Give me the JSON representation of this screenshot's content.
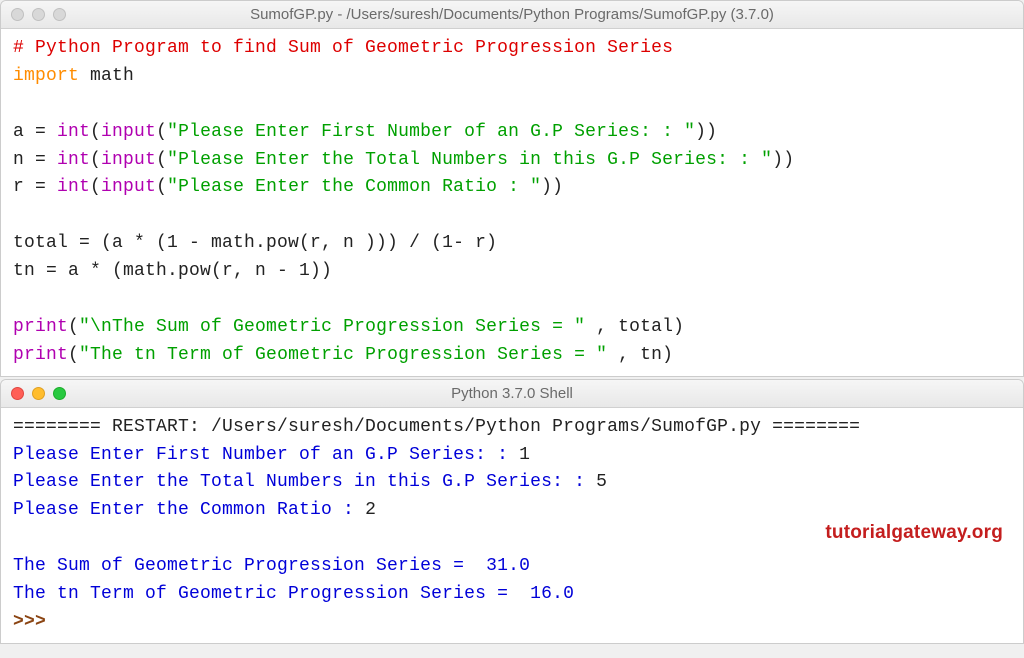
{
  "editor": {
    "title": "SumofGP.py - /Users/suresh/Documents/Python Programs/SumofGP.py (3.7.0)",
    "code": {
      "comment": "# Python Program to find Sum of Geometric Progression Series",
      "import_kw": "import",
      "import_mod": " math",
      "line_a1": "a = ",
      "line_a2": "int",
      "line_a3": "(",
      "line_a4": "input",
      "line_a5": "(",
      "line_a6": "\"Please Enter First Number of an G.P Series: : \"",
      "line_a7": "))",
      "line_n1": "n = ",
      "line_n2": "int",
      "line_n3": "(",
      "line_n4": "input",
      "line_n5": "(",
      "line_n6": "\"Please Enter the Total Numbers in this G.P Series: : \"",
      "line_n7": "))",
      "line_r1": "r = ",
      "line_r2": "int",
      "line_r3": "(",
      "line_r4": "input",
      "line_r5": "(",
      "line_r6": "\"Please Enter the Common Ratio : \"",
      "line_r7": "))",
      "total_line": "total = (a * (1 - math.pow(r, n ))) / (1- r)",
      "tn_line": "tn = a * (math.pow(r, n - 1))",
      "print1_kw": "print",
      "print1_open": "(",
      "print1_str": "\"\\nThe Sum of Geometric Progression Series = \"",
      "print1_rest": " , total)",
      "print2_kw": "print",
      "print2_open": "(",
      "print2_str": "\"The tn Term of Geometric Progression Series = \"",
      "print2_rest": " , tn)"
    }
  },
  "shell": {
    "title": "Python 3.7.0 Shell",
    "restart_line": "======== RESTART: /Users/suresh/Documents/Python Programs/SumofGP.py ========",
    "prompt1": "Please Enter First Number of an G.P Series: : ",
    "input1": "1",
    "prompt2": "Please Enter the Total Numbers in this G.P Series: : ",
    "input2": "5",
    "prompt3": "Please Enter the Common Ratio : ",
    "input3": "2",
    "out1": "The Sum of Geometric Progression Series =  31.0",
    "out2": "The tn Term of Geometric Progression Series =  16.0",
    "prompt_cursor": ">>> "
  },
  "watermark": "tutorialgateway.org"
}
